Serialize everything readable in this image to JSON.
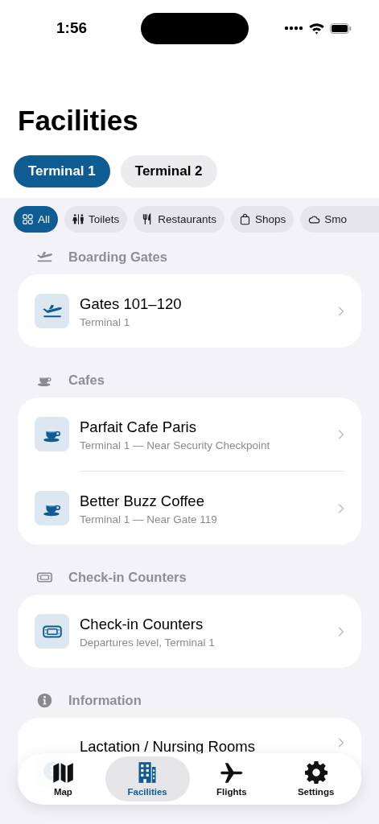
{
  "status_bar": {
    "time": "1:56"
  },
  "title": "Facilities",
  "terminals": [
    {
      "label": "Terminal 1",
      "selected": true
    },
    {
      "label": "Terminal 2",
      "selected": false
    }
  ],
  "filters": [
    {
      "label": "All",
      "kind": "all",
      "selected": true
    },
    {
      "label": "Toilets",
      "kind": "toilets",
      "selected": false
    },
    {
      "label": "Restaurants",
      "kind": "restaurants",
      "selected": false
    },
    {
      "label": "Shops",
      "kind": "shops",
      "selected": false
    },
    {
      "label": "Smo",
      "kind": "smoking",
      "selected": false
    }
  ],
  "sections": [
    {
      "title": "Boarding Gates",
      "kind": "gate",
      "items": [
        {
          "title": "Gates 101–120",
          "subtitle": "Terminal 1"
        }
      ]
    },
    {
      "title": "Cafes",
      "kind": "cafe",
      "items": [
        {
          "title": "Parfait Cafe Paris",
          "subtitle": "Terminal 1 — Near Security Checkpoint"
        },
        {
          "title": "Better Buzz Coffee",
          "subtitle": "Terminal 1 — Near Gate 119"
        }
      ]
    },
    {
      "title": "Check-in Counters",
      "kind": "checkin",
      "items": [
        {
          "title": "Check-in Counters",
          "subtitle": "Departures level, Terminal 1"
        }
      ]
    },
    {
      "title": "Information",
      "kind": "info",
      "items": [
        {
          "title": "Lactation / Nursing Rooms"
        }
      ]
    }
  ],
  "tab_bar": [
    {
      "label": "Map",
      "kind": "map",
      "selected": false
    },
    {
      "label": "Facilities",
      "kind": "facilities",
      "selected": true
    },
    {
      "label": "Flights",
      "kind": "flights",
      "selected": false
    },
    {
      "label": "Settings",
      "kind": "settings",
      "selected": false
    }
  ]
}
